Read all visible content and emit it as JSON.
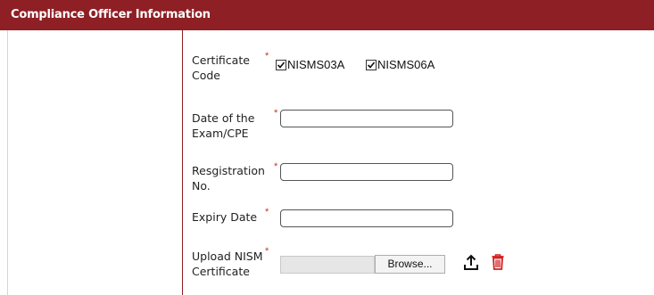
{
  "section": {
    "title": "Compliance Officer Information"
  },
  "form": {
    "certificate_code": {
      "label": "Certificate Code",
      "required_mark": "*",
      "options": [
        {
          "label": "NISMS03A",
          "checked": true
        },
        {
          "label": "NISMS06A",
          "checked": true
        }
      ]
    },
    "exam_date": {
      "label": "Date of the Exam/CPE",
      "required_mark": "*",
      "value": ""
    },
    "registration_no": {
      "label": "Resgistration No.",
      "required_mark": "*",
      "value": ""
    },
    "expiry_date": {
      "label": "Expiry Date",
      "required_mark": "*",
      "value": ""
    },
    "upload": {
      "label": "Upload NISM Certificate",
      "required_mark": "*",
      "browse_label": "Browse...",
      "upload_icon": "upload-icon",
      "delete_icon": "trash-icon"
    }
  },
  "colors": {
    "header_bg": "#8e1f24",
    "required": "#c0392b",
    "delete_icon": "#d21f1f"
  }
}
